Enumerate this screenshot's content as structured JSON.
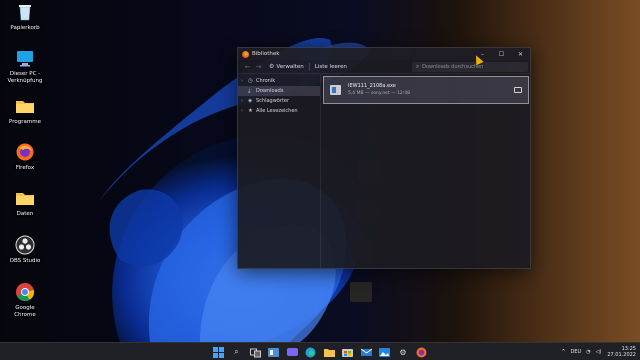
{
  "desktop": {
    "icons": [
      {
        "label": "Papierkorb",
        "icon": "recycle-bin-icon"
      },
      {
        "label": "Dieser PC - Verknüpfung",
        "icon": "computer-icon"
      },
      {
        "label": "Programme",
        "icon": "folder-icon"
      },
      {
        "label": "Firefox",
        "icon": "firefox-icon"
      },
      {
        "label": "Daten",
        "icon": "folder-icon"
      },
      {
        "label": "OBS Studio",
        "icon": "obs-icon"
      },
      {
        "label": "Google Chrome",
        "icon": "chrome-icon"
      }
    ]
  },
  "window": {
    "title": "Bibliothek",
    "controls": {
      "minimize": "–",
      "maximize": "☐",
      "close": "✕"
    },
    "toolbar": {
      "back": "←",
      "forward": "→",
      "manage_label": "Verwalten",
      "clear_label": "Liste leeren",
      "search_placeholder": "Downloads durchsuchen"
    },
    "sidebar": {
      "items": [
        {
          "label": "Chronik",
          "icon": "history-icon",
          "expandable": true,
          "selected": false
        },
        {
          "label": "Downloads",
          "icon": "download-icon",
          "expandable": false,
          "selected": true
        },
        {
          "label": "Schlagwörter",
          "icon": "tag-icon",
          "expandable": true,
          "selected": false
        },
        {
          "label": "Alle Lesezeichen",
          "icon": "star-icon",
          "expandable": true,
          "selected": false
        }
      ]
    },
    "downloads": [
      {
        "filename": "IEW111_2108a.exe",
        "meta": "5,4 MB — sony.net — 12:48"
      }
    ]
  },
  "taskbar": {
    "icons": [
      "windows-start-icon",
      "search-icon",
      "task-view-icon",
      "widgets-icon",
      "chat-icon",
      "edge-icon",
      "explorer-icon",
      "store-icon",
      "mail-icon",
      "photos-icon",
      "settings-icon",
      "firefox-icon"
    ],
    "language": "DEU",
    "time": "13:25",
    "date": "27.01.2022"
  },
  "colors": {
    "window_bg": "#1c1b22",
    "selected_item": "#3b3a46",
    "taskbar_bg": "#202027"
  }
}
